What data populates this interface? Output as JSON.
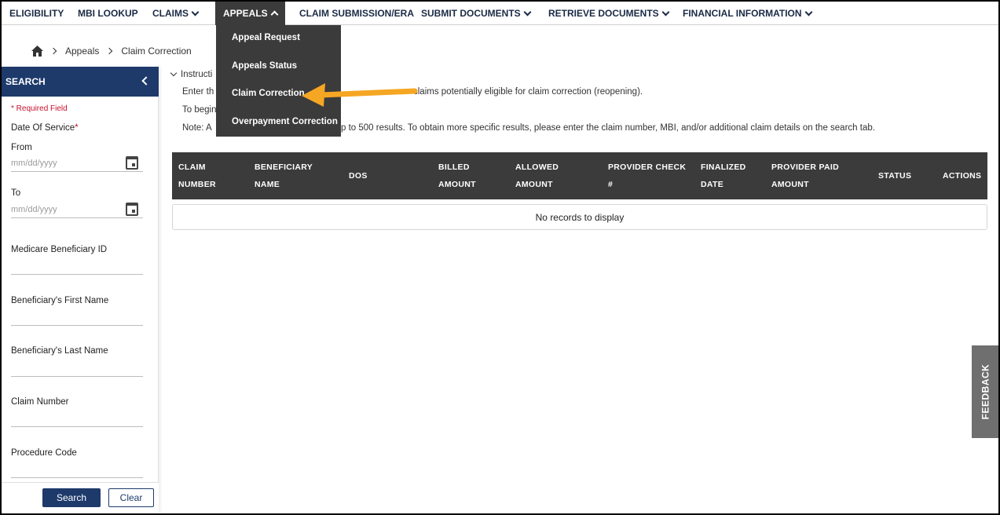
{
  "nav": {
    "items": [
      {
        "label": "ELIGIBILITY",
        "has_chevron": false
      },
      {
        "label": "MBI LOOKUP",
        "has_chevron": false
      },
      {
        "label": "CLAIMS",
        "has_chevron": true
      },
      {
        "label": "APPEALS",
        "has_chevron": true,
        "active": true
      },
      {
        "label": "CLAIM SUBMISSION/ERA",
        "has_chevron": false
      },
      {
        "label": "SUBMIT DOCUMENTS",
        "has_chevron": true
      },
      {
        "label": "RETRIEVE DOCUMENTS",
        "has_chevron": true
      },
      {
        "label": "FINANCIAL INFORMATION",
        "has_chevron": true
      }
    ],
    "dropdown": [
      "Appeal Request",
      "Appeals Status",
      "Claim Correction",
      "Overpayment Correction"
    ]
  },
  "breadcrumb": {
    "items": [
      "Appeals",
      "Claim Correction"
    ]
  },
  "sidebar": {
    "title": "SEARCH",
    "required_note": "* Required Field",
    "date_of_service_label": "Date Of Service",
    "required_star": "*",
    "from_label": "From",
    "from_placeholder": "mm/dd/yyyy",
    "to_label": "To",
    "to_placeholder": "mm/dd/yyyy",
    "fields": [
      "Medicare Beneficiary ID",
      "Beneficiary's First Name",
      "Beneficiary's Last Name",
      "Claim Number",
      "Procedure Code"
    ],
    "search_button": "Search",
    "clear_button": "Clear"
  },
  "instructions": {
    "toggle_label": "Instructi",
    "line1_left": "Enter th",
    "line1_right": "claims potentially eligible for claim correction (reopening).",
    "line2_left": "To begin",
    "line3_left": "Note: A",
    "line3_right": "p to 500 results. To obtain more specific results, please enter the claim number, MBI, and/or additional claim details on the search tab."
  },
  "table": {
    "headers": [
      [
        "CLAIM",
        "NUMBER"
      ],
      [
        "BENEFICIARY",
        "NAME"
      ],
      [
        "DOS"
      ],
      [
        "BILLED",
        "AMOUNT"
      ],
      [
        "ALLOWED",
        "AMOUNT"
      ],
      [
        "PROVIDER CHECK",
        "#"
      ],
      [
        "FINALIZED",
        "DATE"
      ],
      [
        "PROVIDER PAID",
        "AMOUNT"
      ],
      [
        "STATUS"
      ],
      [
        "ACTIONS"
      ]
    ],
    "empty_message": "No records to display"
  },
  "feedback_label": "FEEDBACK",
  "colors": {
    "nav_active_bg": "#3b3b3b",
    "sidebar_header": "#1d3a6b",
    "required_red": "#c8102e",
    "arrow_orange": "#f5a623",
    "table_header_bg": "#3b3b3b"
  }
}
